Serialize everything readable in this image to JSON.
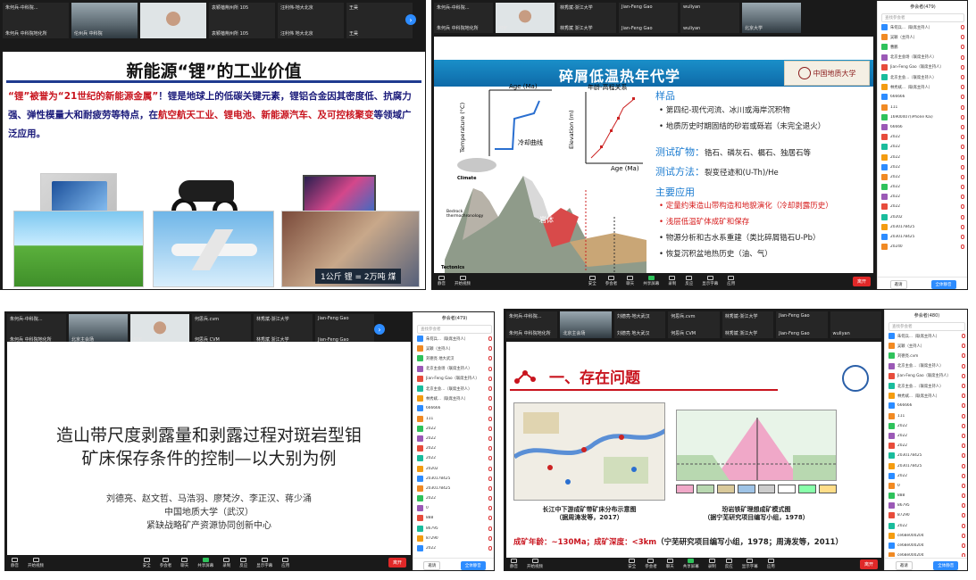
{
  "windows": [
    {
      "id": "w1",
      "participants_strip": [
        {
          "top": "朱何兵-中科院...",
          "bottom": "朱何兵 中科院地化所",
          "video": false
        },
        {
          "top": "",
          "bottom": "伦州兵 中科院",
          "video": true
        },
        {
          "top": "",
          "bottom": "",
          "video": true,
          "face": true
        },
        {
          "top": "袁颖蓓荆州所 105",
          "bottom": "袁颖蓓荆州所 105",
          "video": false
        },
        {
          "top": "汪利伟-地大北京",
          "bottom": "汪利伟 地大北京",
          "video": false
        },
        {
          "top": "王昊",
          "bottom": "王昊",
          "video": false
        }
      ],
      "slide": {
        "title": "新能源“锂”的工业价值",
        "text_parts": [
          {
            "t": "“锂”被誉为“21世纪的新能源金属”",
            "red": true
          },
          {
            "t": "！锂是地球上的低碳关键元素，锂铝合金因其密度低、抗腐力强、弹性模量大和耐疲劳等特点，在",
            "red": false
          },
          {
            "t": "航空航天工业、锂电池、新能源汽车、及可控核聚变",
            "red": true
          },
          {
            "t": "等领域广泛应用。",
            "red": false
          }
        ],
        "caption": "1公斤 锂 = 2万吨 煤"
      }
    },
    {
      "id": "w2",
      "participants_strip": [
        {
          "top": "朱何兵-中科院...",
          "bottom": "朱何兵 中科院地化所",
          "video": false
        },
        {
          "top": "",
          "bottom": "何宇",
          "video": true,
          "face": true
        },
        {
          "top": "林秀斌-浙江大学",
          "bottom": "林秀斌 浙江大学",
          "video": false
        },
        {
          "top": "Jian-Feng Gao",
          "bottom": "Jian-Feng Gao",
          "video": false
        },
        {
          "top": "wuliyan",
          "bottom": "wuliyan",
          "video": false
        },
        {
          "top": "",
          "bottom": "北京大学",
          "video": true
        }
      ],
      "slide": {
        "title": "碎屑低温热年代学",
        "logo": "中国地质大学",
        "diagram_labels": {
          "age_ma_1": "Age (Ma)",
          "temperature": "Temperature (°C)",
          "cooling": "冷却曲线",
          "age_elev": "年龄-高程关系",
          "elevation": "Elevation (m)",
          "age_ma_2": "Age (Ma)",
          "climate": "Climate",
          "bedrock": "Bedrock thermochronology",
          "rock": "岩体",
          "tectonics": "Tectonics"
        },
        "h_sample": "样品",
        "sample_items": [
          "第四纪-现代河流、冰川或海岸沉积物",
          "地质历史时期固结的砂岩或砾岩（未完全退火）"
        ],
        "h_mineral_label": "测试矿物：",
        "mineral_value": "锆石、磷灰石、榍石、独居石等",
        "h_method_label": "测试方法：",
        "method_value": "裂变径迹和(U-Th)/He",
        "h_app": "主要应用",
        "app_items": [
          {
            "t": "定量约束造山带构造和地貌演化（冷却剥露历史）",
            "red": true
          },
          {
            "t": "浅层低温矿体成矿和保存",
            "red": true
          },
          {
            "t": "物源分析和古水系重建（类比碎屑锆石U-Pb）",
            "red": false
          },
          {
            "t": "恢复沉积盆地热历史（油、气）",
            "red": false
          }
        ]
      },
      "panel": {
        "title": "参会者(479)",
        "search": "查找参会者",
        "participants": [
          "朱何兵...（联席主持人）",
          "吴颖（主持人）",
          "曹鹏",
          "北京主会场（联席主持人）",
          "Jian-Feng Gao（联席主持人）",
          "北京主会...（联席主持人）",
          "林秀斌...（联席主持人）",
          "666666",
          "111",
          "16900407(iPhone Kai)",
          "66666",
          "2022",
          "2022",
          "2022",
          "2022",
          "2022",
          "2022",
          "2022",
          "2022",
          "20202",
          "2030178425",
          "2030178425",
          "20240"
        ],
        "invite": "邀请",
        "mute_all": "全体静音"
      }
    },
    {
      "id": "w3",
      "participants_strip": [
        {
          "top": "朱何兵-中科院...",
          "bottom": "朱何兵 中科院地化所",
          "video": false
        },
        {
          "top": "",
          "bottom": "北京主会场",
          "video": true
        },
        {
          "top": "",
          "bottom": "何宇",
          "video": true,
          "face": true
        },
        {
          "top": "何思兵.cvm",
          "bottom": "何思兵 CVM",
          "video": false
        },
        {
          "top": "林秀斌-浙江大学",
          "bottom": "林秀斌 浙江大学",
          "video": false
        },
        {
          "top": "Jian-Feng Gao",
          "bottom": "Jian-Feng Gao",
          "video": false
        }
      ],
      "slide": {
        "title_line1": "造山带尺度剥露量和剥露过程对斑岩型钼",
        "title_line2": "矿床保存条件的控制—以大别为例",
        "authors": "刘德亮、赵文哲、马浩羽、廖梵汐、李正汉、蒋少涌",
        "affil1": "中国地质大学（武汉）",
        "affil2": "紧缺战略矿产资源协同创新中心"
      },
      "panel": {
        "title": "参会者(479)",
        "search": "查找参会者",
        "participants": [
          "朱何兵...（联席主持人）",
          "吴颖（主持人）",
          "刘德亮 地大武汉",
          "北京主会场（联席主持人）",
          "Jian-Feng Gao（联席主持人）",
          "北京主会...（联席主持人）",
          "林秀斌...（联席主持人）",
          "666666",
          "111",
          "2022",
          "2022",
          "2022",
          "2022",
          "20202",
          "2030178425",
          "2030178425",
          "2022",
          "0",
          "888",
          "86795",
          "87290",
          "2022"
        ],
        "invite": "邀请",
        "mute_all": "全体静音"
      }
    },
    {
      "id": "w4",
      "participants_strip": [
        {
          "top": "朱何兵-中科院...",
          "bottom": "朱何兵 中科院地化所",
          "video": false
        },
        {
          "top": "",
          "bottom": "北京主会场",
          "video": true
        },
        {
          "top": "刘德亮-地大武汉",
          "bottom": "刘德亮 地大武汉",
          "video": false
        },
        {
          "top": "何思兵.cvm",
          "bottom": "何思兵 CVM",
          "video": false
        },
        {
          "top": "林秀斌-浙江大学",
          "bottom": "林秀斌 浙江大学",
          "video": false
        },
        {
          "top": "Jian-Feng Gao",
          "bottom": "Jian-Feng Gao",
          "video": false
        },
        {
          "top": "",
          "bottom": "wuliyan",
          "video": false
        }
      ],
      "slide": {
        "title": "一、存在问题",
        "caption_left_1": "长江中下游成矿带矿床分布示意图",
        "caption_left_2": "（据周涛发等，2017）",
        "caption_right_1": "玢岩铁矿理想成矿模式图",
        "caption_right_2": "（据宁芜研究项目编写小组，1978）",
        "foot_age_label": "成矿年龄：",
        "foot_age_value": "~130Ma",
        "foot_depth_label": "；成矿深度：",
        "foot_depth_value": "<3km",
        "foot_ref": "（宁芜研究项目编写小组，1978；周涛发等，2011）"
      },
      "panel": {
        "title": "参会者(480)",
        "search": "查找参会者",
        "participants": [
          "朱何兵...（联席主持人）",
          "吴颖（主持人）",
          "刘德亮.cvm",
          "北京主会...（联席主持人）",
          "Jian-Feng Gao（联席主持人）",
          "北京主会...（联席主持人）",
          "林秀斌...（联席主持人）",
          "666666",
          "111",
          "2022",
          "2022",
          "2022",
          "2030178425",
          "2030178425",
          "2022",
          "0",
          "888",
          "86795",
          "87290",
          "2022",
          "ce68e000204",
          "ce68e000204",
          "ce68e000204"
        ],
        "invite": "邀请",
        "mute_all": "全体静音"
      }
    }
  ],
  "toolbar": {
    "left": [
      "静音",
      "开始视频"
    ],
    "center": [
      "安全",
      "参会者",
      "聊天",
      "共享屏幕",
      "录制",
      "反应",
      "显示字幕",
      "应用"
    ],
    "center_counts": {
      "w2": "477",
      "w3": "479",
      "w4": "480"
    },
    "end": "离开"
  },
  "colors": {
    "zoom_blue": "#2d8cff",
    "end_red": "#e02828",
    "slide_red": "#c8141e",
    "banner_blue": "#1a8fc9"
  }
}
